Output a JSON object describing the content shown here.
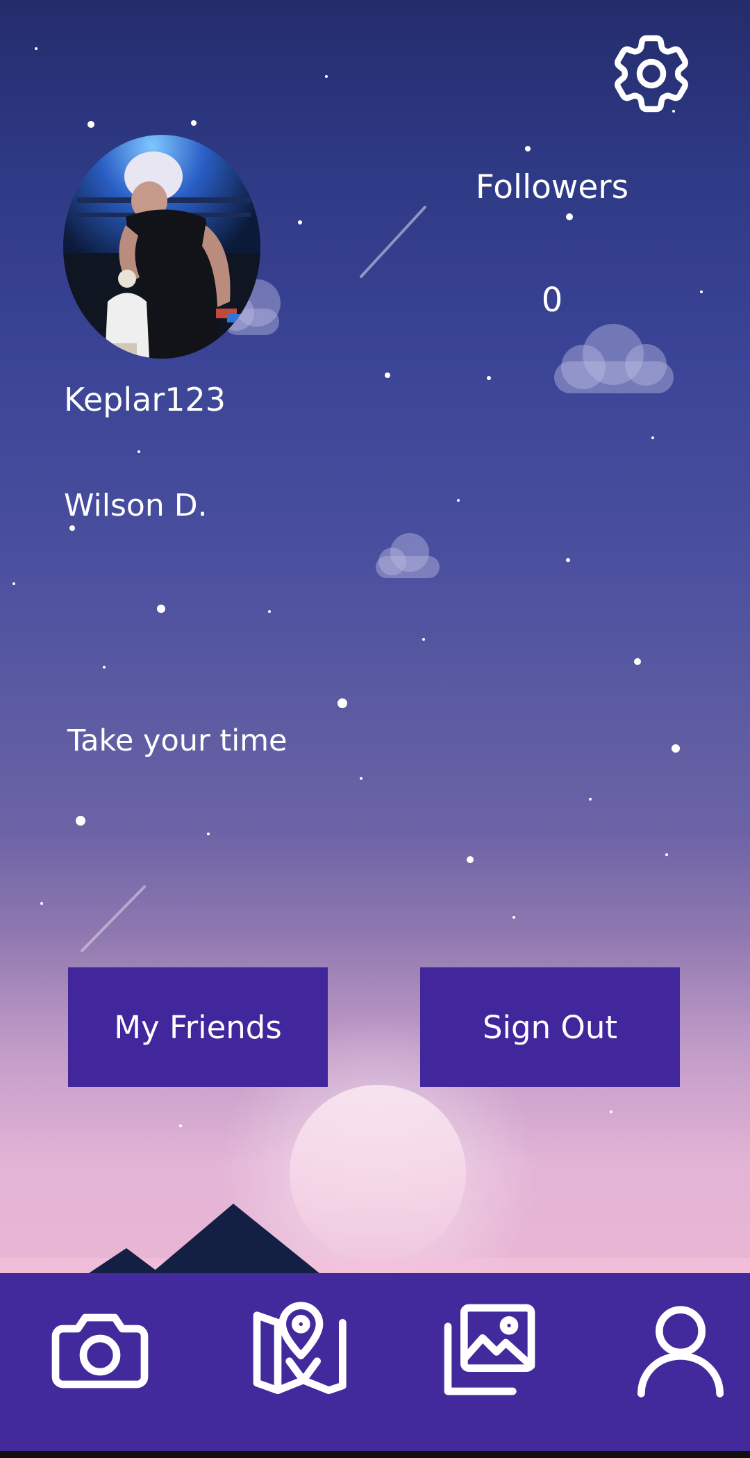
{
  "profile": {
    "username": "Keplar123",
    "display_name": "Wilson D.",
    "bio": "Take your time"
  },
  "followers": {
    "label": "Followers",
    "count": "0"
  },
  "buttons": {
    "friends": "My Friends",
    "sign_out": "Sign Out"
  },
  "nav": {
    "items": [
      {
        "icon": "camera-icon"
      },
      {
        "icon": "map-pin-icon"
      },
      {
        "icon": "gallery-icon"
      },
      {
        "icon": "user-icon"
      }
    ]
  },
  "colors": {
    "primary": "#42299c",
    "button": "#41279b",
    "text": "#ffffff",
    "sky_top": "#242c6c",
    "sky_bottom": "#e9b3d3",
    "mountain": "#141f44"
  }
}
